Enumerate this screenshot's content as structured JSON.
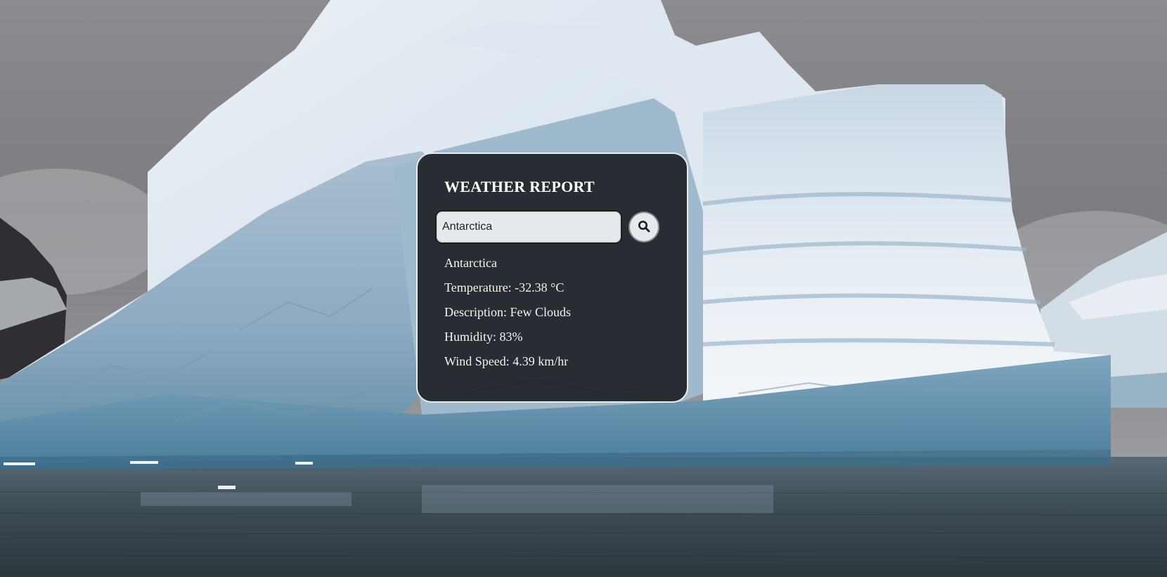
{
  "card": {
    "title": "WEATHER REPORT"
  },
  "search": {
    "value": "Antarctica",
    "button_icon": "search-icon"
  },
  "report": {
    "location": "Antarctica",
    "temperature": "Temperature: -32.38 °C",
    "description": "Description: Few Clouds",
    "humidity": "Humidity: 83%",
    "wind_speed": "Wind Speed: 4.39 km/hr"
  },
  "colors": {
    "card_background": "#14161a",
    "card_border": "#e9ecef",
    "input_background": "#e6e9ee",
    "sky": "#8f8f94",
    "water": "#3d4a54"
  },
  "background": {
    "subject": "iceberg"
  }
}
